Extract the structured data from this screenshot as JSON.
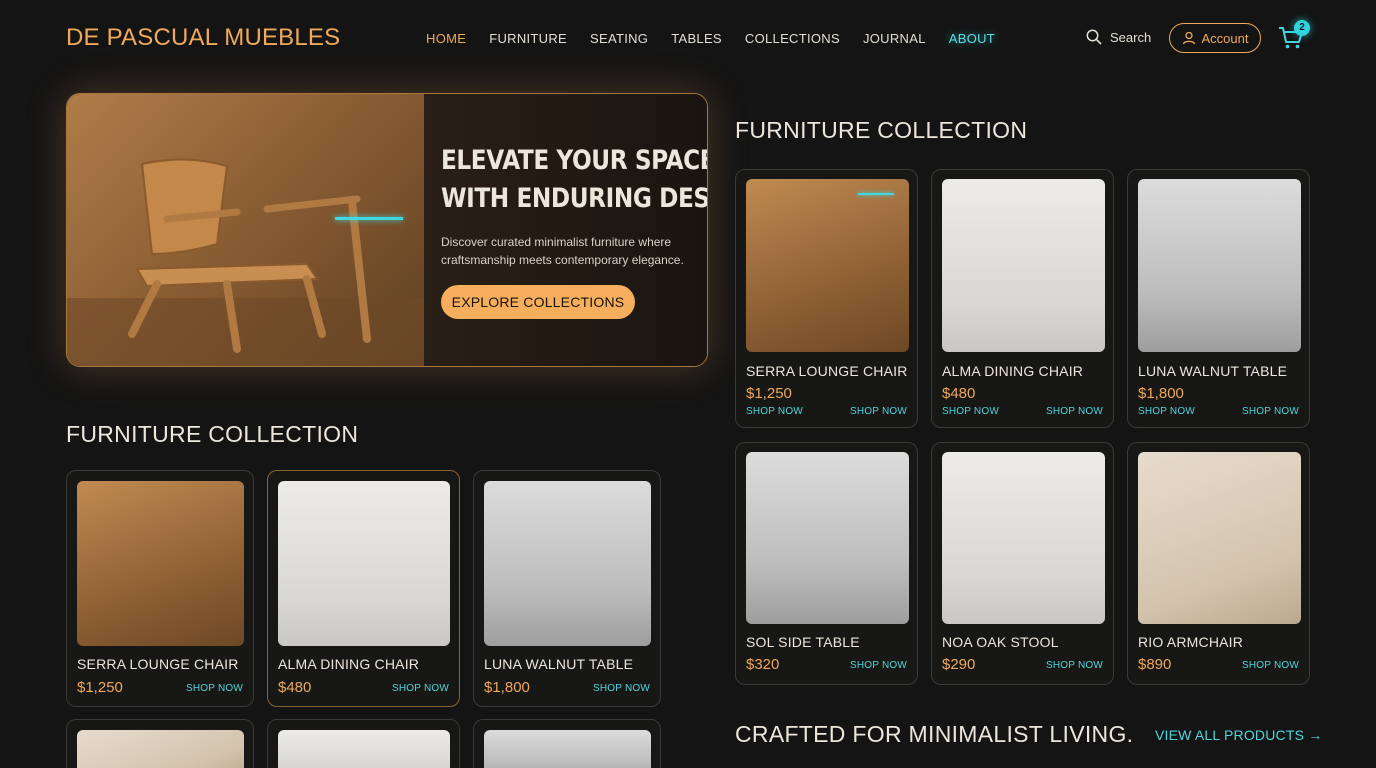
{
  "brand": {
    "name": "DE PASCUAL MUEBLES"
  },
  "nav": {
    "items": [
      {
        "label": "HOME"
      },
      {
        "label": "FURNITURE"
      },
      {
        "label": "SEATING"
      },
      {
        "label": "TABLES"
      },
      {
        "label": "COLLECTIONS"
      },
      {
        "label": "JOURNAL"
      },
      {
        "label": "ABOUT"
      }
    ]
  },
  "header": {
    "search_label": "Search",
    "account_label": "Account",
    "cart_count": "2"
  },
  "hero": {
    "title_line1": "ELEVATE YOUR SPACE",
    "title_line2": "WITH ENDURING DESIGN.",
    "subtitle": "Discover curated minimalist furniture where craftsmanship meets contemporary elegance.",
    "cta": "EXPLORE COLLECTIONS"
  },
  "left_collection": {
    "title": "FURNITURE COLLECTION",
    "products": [
      {
        "name": "SERRA LOUNGE CHAIR",
        "price": "$1,250",
        "shop": "SHOP NOW"
      },
      {
        "name": "ALMA DINING CHAIR",
        "price": "$480",
        "shop": "SHOP NOW"
      },
      {
        "name": "LUNA WALNUT TABLE",
        "price": "$1,800",
        "shop": "SHOP NOW"
      }
    ]
  },
  "right_collection": {
    "title": "FURNITURE COLLECTION",
    "products": [
      {
        "name": "SERRA LOUNGE CHAIR",
        "price": "$1,250",
        "shop_a": "SHOP NOW",
        "shop_b": "SHOP NOW"
      },
      {
        "name": "ALMA DINING CHAIR",
        "price": "$480",
        "shop_a": "SHOP NOW",
        "shop_b": "SHOP NOW"
      },
      {
        "name": "LUNA WALNUT TABLE",
        "price": "$1,800",
        "shop_a": "SHOP NOW",
        "shop_b": "SHOP NOW"
      },
      {
        "name": "SOL SIDE TABLE",
        "price": "$320",
        "shop": "SHOP NOW"
      },
      {
        "name": "NOA OAK STOOL",
        "price": "$290",
        "shop": "SHOP NOW"
      },
      {
        "name": "RIO ARMCHAIR",
        "price": "$890",
        "shop": "SHOP NOW"
      }
    ]
  },
  "bottom": {
    "tagline": "CRAFTED FOR MINIMALIST LIVING.",
    "view_all": "VIEW ALL PRODUCTS →"
  },
  "colors": {
    "accent": "#f0a95a",
    "highlight": "#4fd6dc",
    "background": "#141414"
  }
}
